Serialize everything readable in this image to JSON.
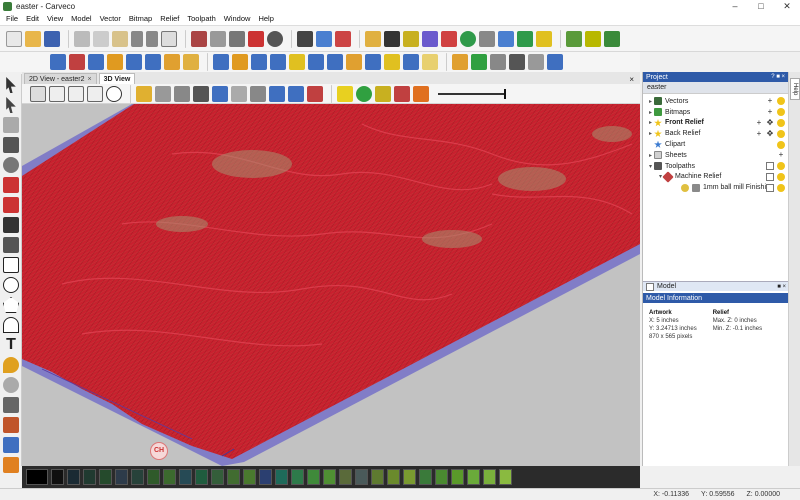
{
  "window": {
    "title": "easter - Carveco"
  },
  "menu": [
    "File",
    "Edit",
    "View",
    "Model",
    "Vector",
    "Bitmap",
    "Relief",
    "Toolpath",
    "Window",
    "Help"
  ],
  "view_tabs": [
    {
      "label": "2D View - easter2",
      "active": false
    },
    {
      "label": "3D View",
      "active": true
    }
  ],
  "project": {
    "panel_title": "Project",
    "root": "easter",
    "items": [
      {
        "label": "Vectors",
        "bold": false
      },
      {
        "label": "Bitmaps",
        "bold": false
      },
      {
        "label": "Front Relief",
        "bold": true
      },
      {
        "label": "Back Relief",
        "bold": false
      },
      {
        "label": "Clipart",
        "bold": false
      },
      {
        "label": "Sheets",
        "bold": false
      },
      {
        "label": "Toolpaths",
        "bold": false
      },
      {
        "label": "Machine Relief",
        "bold": false
      },
      {
        "label": "1mm ball mill Finishing",
        "bold": false
      }
    ]
  },
  "model_panel": {
    "tab_label": "Model",
    "header": "Model Information",
    "artwork": {
      "title": "Artwork",
      "x": "X: 5 inches",
      "y": "Y: 3.24713 inches",
      "pixels": "870 x 565 pixels"
    },
    "relief": {
      "title": "Relief",
      "max_z": "Max. Z: 0 inches",
      "min_z": "Min. Z: -0.1 inches"
    }
  },
  "viewport": {
    "badge": "CH"
  },
  "status": {
    "x": "X: -0.11336",
    "y": "Y: 0.59556",
    "z": "Z: 0.00000"
  },
  "help_tab": "Help",
  "palette_colors": [
    "#101010",
    "#1a2a33",
    "#203a30",
    "#254a2c",
    "#2d3b4a",
    "#27423a",
    "#2f5a2a",
    "#3c6a2e",
    "#264a55",
    "#1f5c3e",
    "#345e3a",
    "#416c30",
    "#4a7a2e",
    "#2b3f70",
    "#1e6a5a",
    "#2d7a4a",
    "#3f8a3a",
    "#4f8f33",
    "#5a6a3a",
    "#4a5a5a",
    "#5e7a30",
    "#6a8a2c",
    "#7a9a30",
    "#3a7a3a",
    "#4a8a30",
    "#5a9a2a",
    "#6aaa3a",
    "#7ab03c",
    "#8aba40"
  ]
}
